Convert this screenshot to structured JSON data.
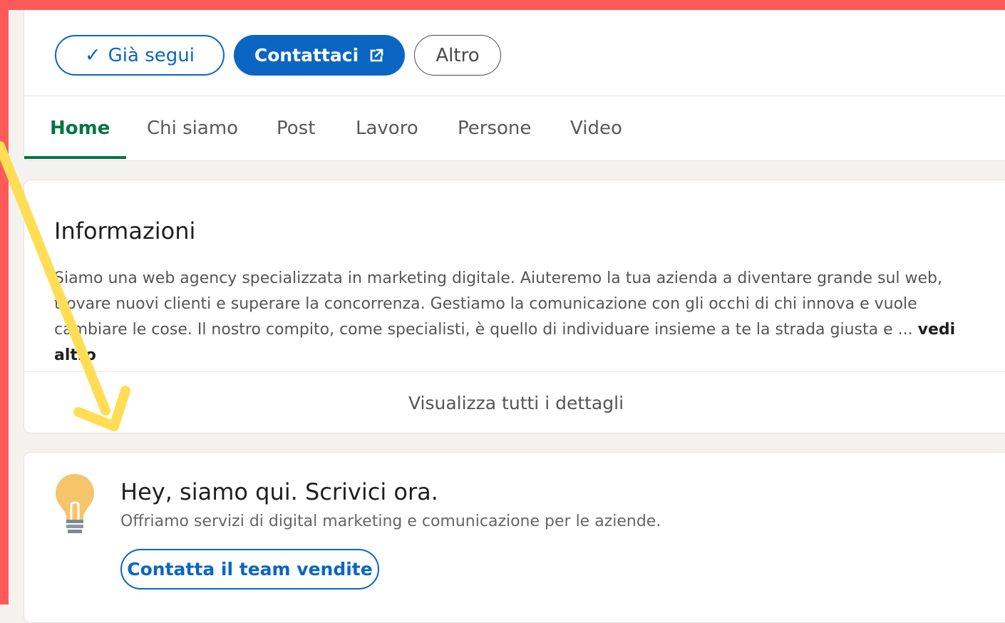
{
  "header": {
    "follow_check": "✓",
    "follow_label": "Già segui",
    "contact_label": "Contattaci",
    "more_label": "Altro"
  },
  "tabs": [
    {
      "label": "Home",
      "active": true
    },
    {
      "label": "Chi siamo"
    },
    {
      "label": "Post"
    },
    {
      "label": "Lavoro"
    },
    {
      "label": "Persone"
    },
    {
      "label": "Video"
    }
  ],
  "about": {
    "title": "Informazioni",
    "text": "Siamo una web agency specializzata in marketing digitale. Aiuteremo la tua azienda a diventare grande sul web, trovare nuovi clienti e superare la concorrenza. Gestiamo la comunicazione con gli occhi di chi innova e vuole cambiare le cose. Il nostro compito, come specialisti, è quello di individuare insieme a te la strada giusta e ...",
    "see_more": "vedi altro",
    "details_link": "Visualizza tutti i dettagli"
  },
  "cta": {
    "title": "Hey, siamo qui. Scrivici ora.",
    "subtitle": "Offriamo servizi di digital marketing e comunicazione per le aziende.",
    "button": "Contatta il team vendite"
  },
  "colors": {
    "frame": "#fe5a5a",
    "brand_blue": "#0a66c2",
    "active_tab_green": "#057642",
    "arrow_yellow": "#ffdd55",
    "bulb": "#f5c46b"
  },
  "icons": [
    "check-icon",
    "external-link-icon",
    "lightbulb-icon",
    "annotation-arrow"
  ]
}
